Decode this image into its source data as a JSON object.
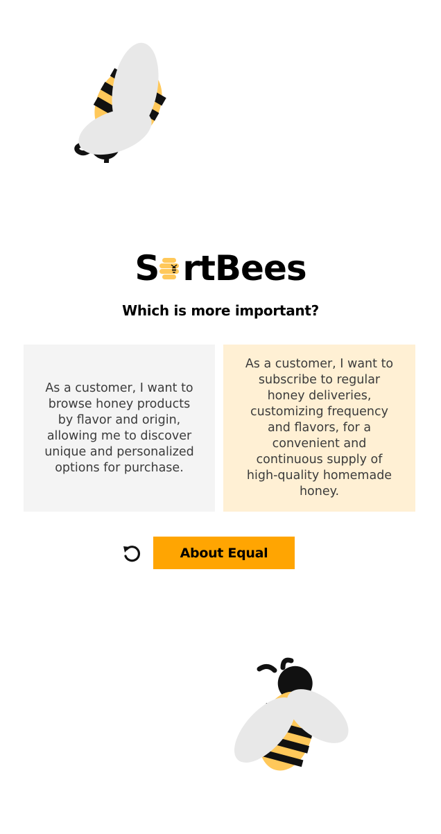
{
  "logo": {
    "text_before": "S",
    "text_after": "rtBees"
  },
  "question": "Which is more important?",
  "cards": {
    "left": "As a customer, I want to browse honey products by flavor and origin, allowing me to discover unique and personalized options for purchase.",
    "right": "As a customer, I want to subscribe to regular honey deliveries, customizing frequency and flavors, for a convenient and continuous supply of high-quality homemade honey."
  },
  "actions": {
    "undo_icon": "undo-icon",
    "equal_label": "About Equal"
  },
  "colors": {
    "accent": "#ffa502",
    "left_card_bg": "#f4f4f4",
    "right_card_bg": "#fff0d4",
    "bee_yellow": "#ffc85a",
    "wing_gray": "#e8e8e8"
  }
}
